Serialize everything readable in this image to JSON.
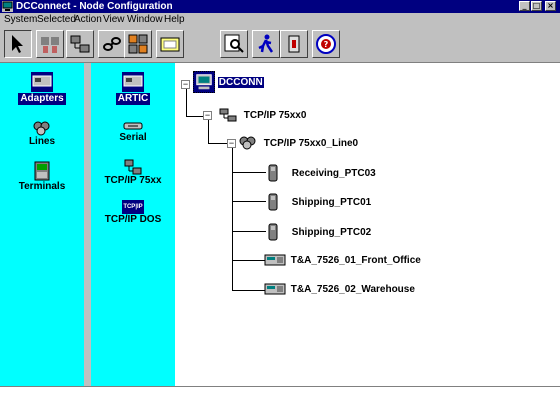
{
  "window": {
    "title": "DCConnect - Node Configuration"
  },
  "menu": [
    "System",
    "Selected",
    "Action",
    "View",
    "Window",
    "Help"
  ],
  "toolbar": {
    "buttons": [
      "pointer-icon",
      "people-icon",
      "nodes-icon",
      "chain-icon",
      "config-icon",
      "folder-icon",
      "search-icon",
      "run-icon",
      "switch-icon",
      "help-icon"
    ]
  },
  "panel1": {
    "items": [
      {
        "label": "Adapters",
        "selected": true
      },
      {
        "label": "Lines",
        "selected": false
      },
      {
        "label": "Terminals",
        "selected": false
      }
    ]
  },
  "panel2": {
    "items": [
      {
        "label": "ARTIC",
        "selected": true
      },
      {
        "label": "Serial",
        "selected": false
      },
      {
        "label": "TCP/IP 75xx",
        "selected": false
      },
      {
        "label": "TCP/IP DOS",
        "selected": false
      }
    ],
    "tcpip_badge": "TCP|IP"
  },
  "tree": {
    "root": "DCCONN",
    "level1": "TCP/IP 75xx0",
    "level2": "TCP/IP 75xx0_Line0",
    "terminals": [
      "Receiving_PTC03",
      "Shipping_PTC01",
      "Shipping_PTC02",
      "T&A_7526_01_Front_Office",
      "T&A_7526_02_Warehouse"
    ],
    "expander": "−"
  }
}
